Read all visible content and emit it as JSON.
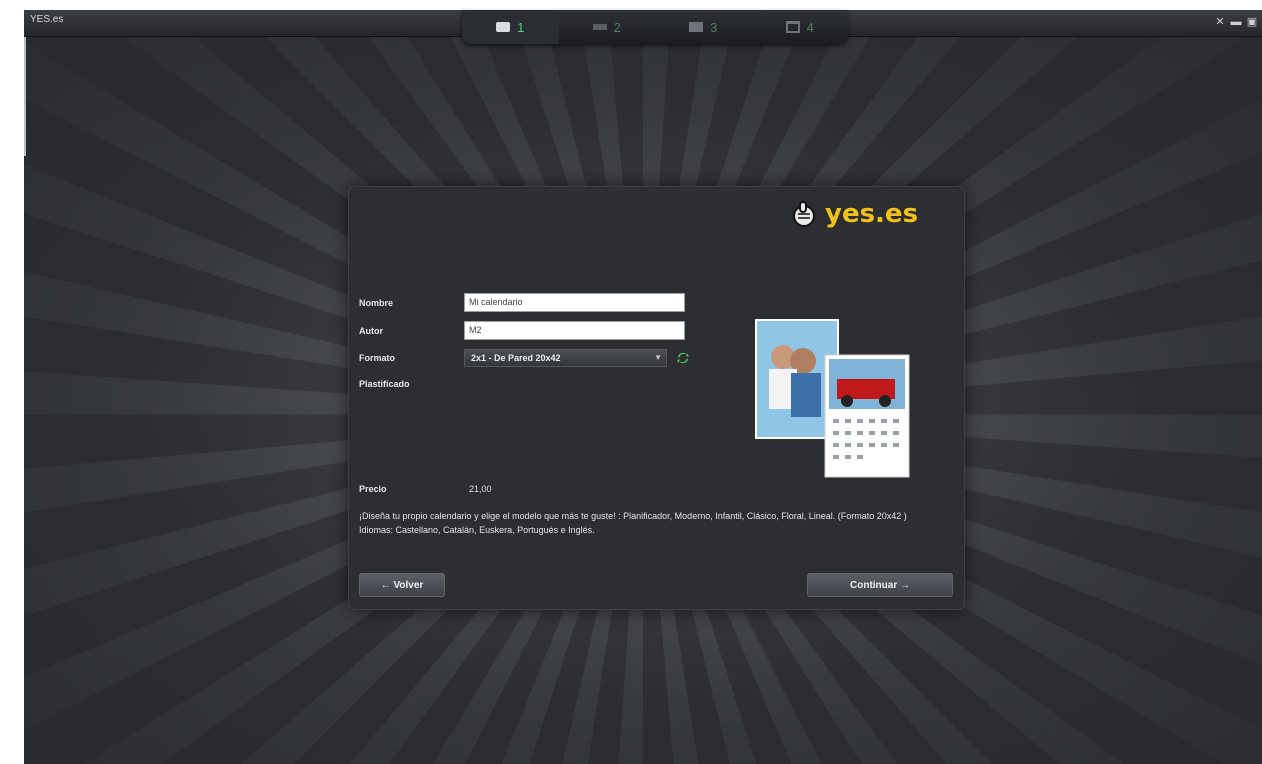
{
  "window": {
    "title": "YES.es",
    "controls": [
      "✕",
      "▬",
      "▣"
    ]
  },
  "steps": [
    {
      "number": "1",
      "icon": "book-icon",
      "active": true
    },
    {
      "number": "2",
      "icon": "step2-icon",
      "active": false
    },
    {
      "number": "3",
      "icon": "step3-icon",
      "active": false
    },
    {
      "number": "4",
      "icon": "cart-icon",
      "active": false
    }
  ],
  "logo": {
    "text": "yes.es",
    "color": "#f2c21a"
  },
  "form": {
    "nombre_label": "Nombre",
    "nombre_value": "Mi calendario",
    "autor_label": "Autor",
    "autor_value": "M2",
    "formato_label": "Formato",
    "formato_value": "2x1 - De Pared 20x42",
    "plastificado_label": "Plastificado"
  },
  "price": {
    "label": "Precio",
    "value": "21,00"
  },
  "description": {
    "line1": "¡Diseña tu propio calendario y elige el modelo que más te guste! : Planificador, Moderno, Infantil, Clásico, Floral, Lineal. (Formato 20x42 )",
    "line2": "Idiomas: Castellano, Catalán, Euskera, Portugués e Inglés."
  },
  "buttons": {
    "back": "← Volver",
    "next": "Continuar →"
  },
  "colors": {
    "accent_green": "#5ecf7a",
    "logo_yellow": "#f2c21a",
    "dialog_bg": "#2c2e32"
  }
}
